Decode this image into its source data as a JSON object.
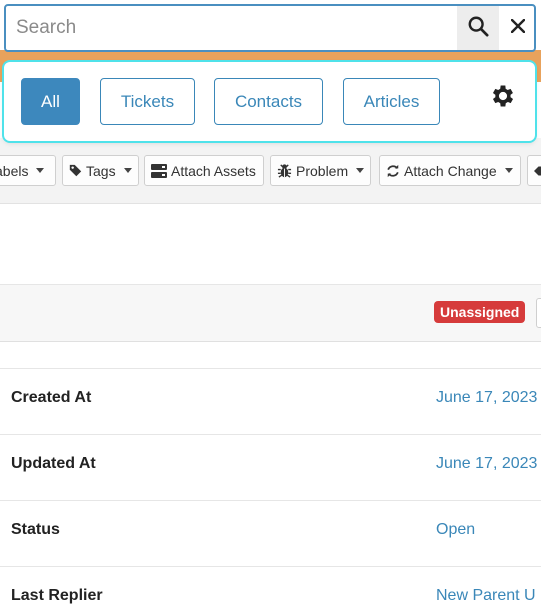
{
  "search": {
    "placeholder": "Search",
    "value": ""
  },
  "filters": {
    "items": [
      {
        "label": "All",
        "active": true
      },
      {
        "label": "Tickets",
        "active": false
      },
      {
        "label": "Contacts",
        "active": false
      },
      {
        "label": "Articles",
        "active": false
      }
    ]
  },
  "toolbar": {
    "labels": "abels",
    "tags": "Tags",
    "attach_assets": "Attach Assets",
    "problem": "Problem",
    "attach_change": "Attach Change"
  },
  "ticket": {
    "badge": "Unassigned",
    "badge_color": "#d63b3b"
  },
  "details": [
    {
      "label": "Created At",
      "value": "June 17, 2023"
    },
    {
      "label": "Updated At",
      "value": "June 17, 2023"
    },
    {
      "label": "Status",
      "value": "Open"
    },
    {
      "label": "Last Replier",
      "value": "New Parent U"
    }
  ],
  "colors": {
    "accent": "#3a87b8",
    "panel_outline": "#4fe2ea",
    "top_bar": "#e8a25c"
  },
  "icons": {
    "search": "search-icon",
    "clear": "close-icon",
    "settings": "gear-icon",
    "tag": "tag-icon",
    "assets": "server-icon",
    "problem": "bug-icon",
    "change": "refresh-icon"
  }
}
